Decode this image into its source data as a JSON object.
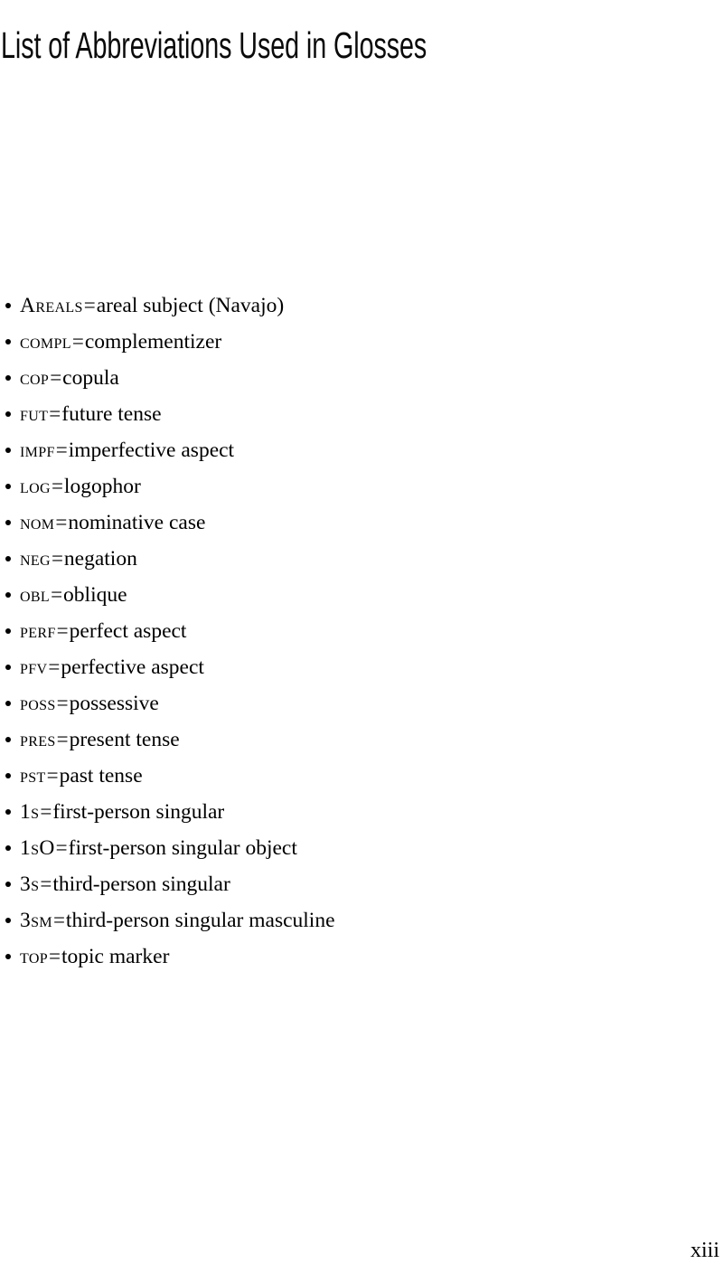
{
  "document": {
    "title": "List of Abbreviations Used in Glosses",
    "folio": "xiii",
    "separator": "=",
    "bullet_icon": "bullet-icon"
  },
  "abbreviations": [
    {
      "term": "Areals",
      "definition": "areal subject (Navajo)"
    },
    {
      "term": "compl",
      "definition": "complementizer"
    },
    {
      "term": "cop",
      "definition": "copula"
    },
    {
      "term": "fut",
      "definition": "future tense"
    },
    {
      "term": "impf",
      "definition": "imperfective aspect"
    },
    {
      "term": "log",
      "definition": "logophor"
    },
    {
      "term": "nom",
      "definition": "nominative case"
    },
    {
      "term": "neg",
      "definition": "negation"
    },
    {
      "term": "obl",
      "definition": "oblique"
    },
    {
      "term": "perf",
      "definition": "perfect aspect"
    },
    {
      "term": "pfv",
      "definition": "perfective aspect"
    },
    {
      "term": "poss",
      "definition": "possessive"
    },
    {
      "term": "pres",
      "definition": "present tense"
    },
    {
      "term": "pst",
      "definition": "past tense"
    },
    {
      "term": "1s",
      "definition": "first-person singular"
    },
    {
      "term": "1sO",
      "definition": "first-person singular object"
    },
    {
      "term": "3s",
      "definition": "third-person singular"
    },
    {
      "term": "3sm",
      "definition": "third-person singular masculine"
    },
    {
      "term": "top",
      "definition": "topic marker"
    }
  ]
}
